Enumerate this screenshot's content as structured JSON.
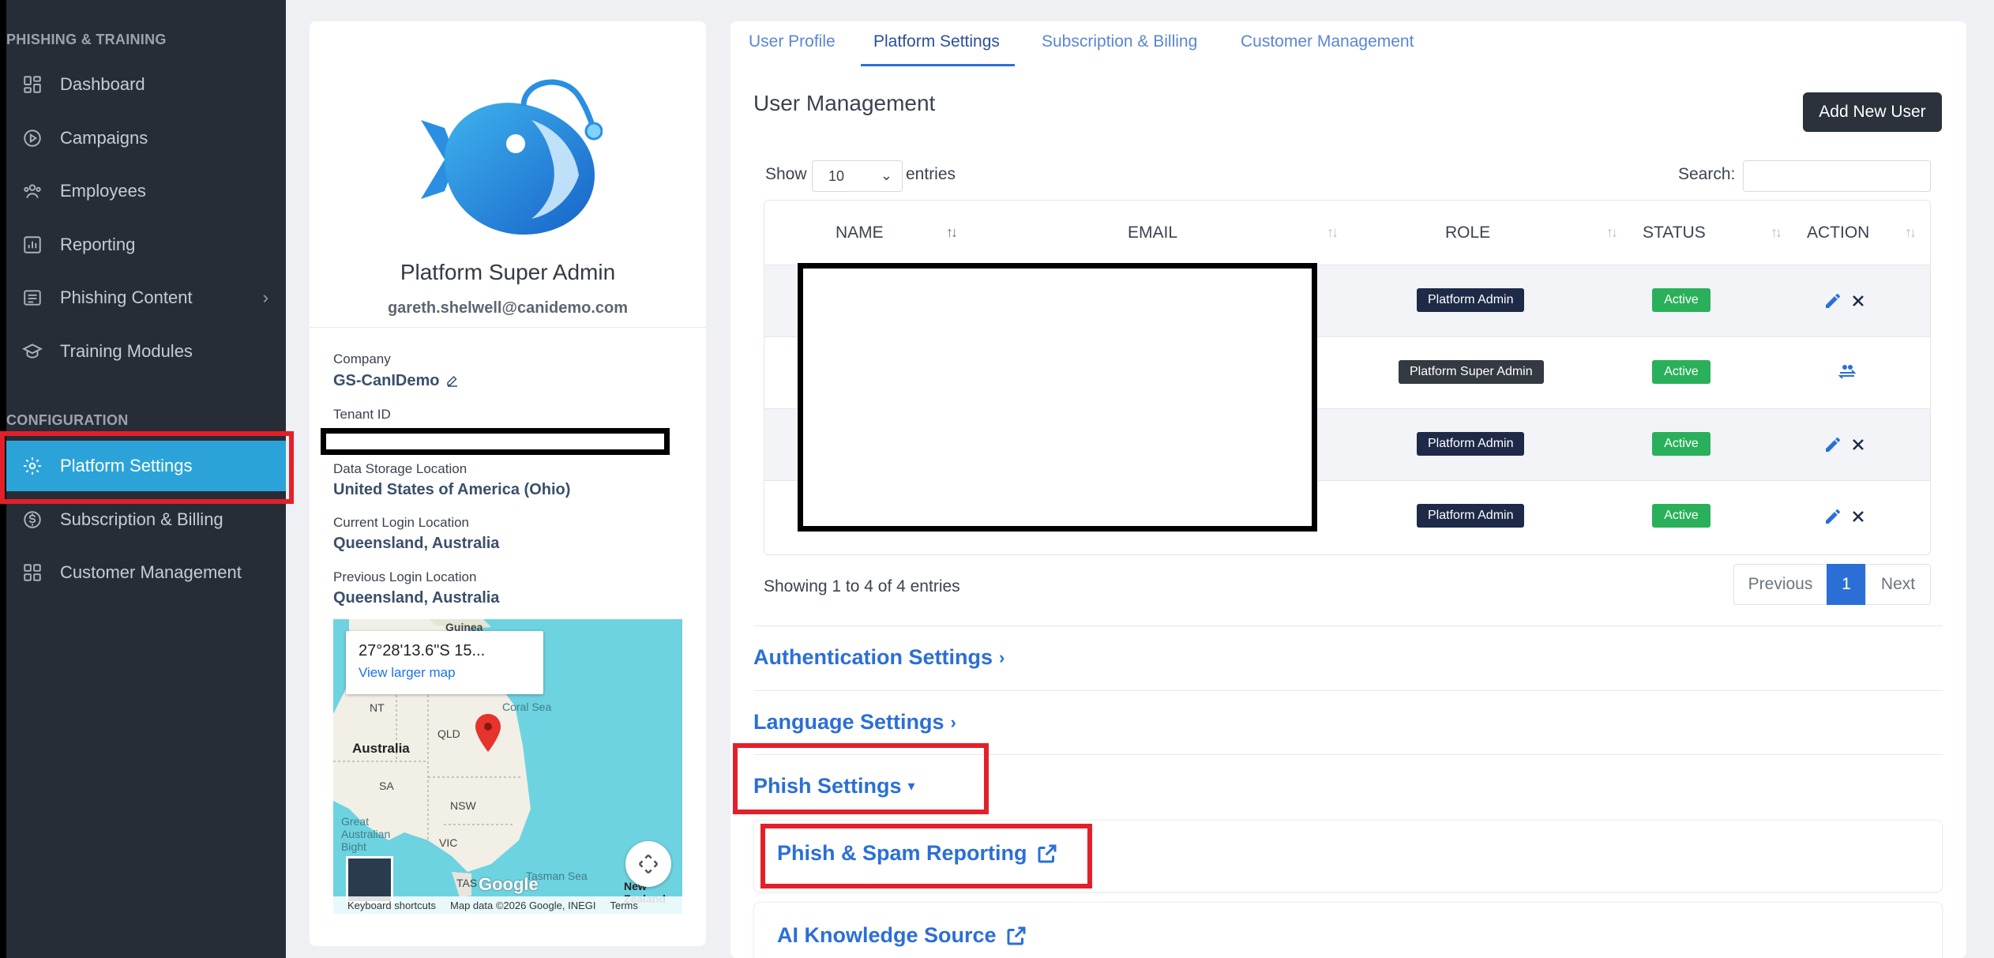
{
  "sidebar": {
    "section_phishing": "PHISHING & TRAINING",
    "section_config": "CONFIGURATION",
    "items": [
      {
        "label": "Dashboard",
        "icon": "dashboard-icon"
      },
      {
        "label": "Campaigns",
        "icon": "play-circle-icon"
      },
      {
        "label": "Employees",
        "icon": "users-icon"
      },
      {
        "label": "Reporting",
        "icon": "chart-icon"
      },
      {
        "label": "Phishing Content",
        "icon": "content-icon"
      },
      {
        "label": "Training Modules",
        "icon": "graduation-cap-icon"
      },
      {
        "label": "Platform Settings",
        "icon": "gear-icon"
      },
      {
        "label": "Subscription & Billing",
        "icon": "dollar-circle-icon"
      },
      {
        "label": "Customer Management",
        "icon": "grid-icon"
      }
    ]
  },
  "profile": {
    "name": "Platform Super Admin",
    "email": "gareth.shelwell@canidemo.com",
    "company_label": "Company",
    "company_value": "GS-CanIDemo",
    "tenant_label": "Tenant ID",
    "storage_label": "Data Storage Location",
    "storage_value": "United States of America (Ohio)",
    "current_login_label": "Current Login Location",
    "current_login_value": "Queensland, Australia",
    "previous_login_label": "Previous Login Location",
    "previous_login_value": "Queensland, Australia"
  },
  "map": {
    "coord": "27°28'13.6\"S 15...",
    "larger_link": "View larger map",
    "labels": {
      "guinea": "Guinea",
      "coral_sea": "Coral Sea",
      "nt": "NT",
      "qld": "QLD",
      "australia": "Australia",
      "sa": "SA",
      "nsw": "NSW",
      "great_bight": "Great\nAustralian\nBight",
      "vic": "VIC",
      "tas": "TAS",
      "tasman": "Tasman Sea",
      "nz": "New\nZealand"
    },
    "google": "Google",
    "footer_shortcuts": "Keyboard shortcuts",
    "footer_data": "Map data ©2026 Google, INEGI",
    "footer_terms": "Terms"
  },
  "tabs": [
    "User Profile",
    "Platform Settings",
    "Subscription & Billing",
    "Customer Management"
  ],
  "user_management": {
    "title": "User Management",
    "add_button": "Add New User",
    "show_label": "Show",
    "entries_value": "10",
    "entries_label": "entries",
    "search_label": "Search:",
    "columns": [
      "NAME",
      "EMAIL",
      "ROLE",
      "STATUS",
      "ACTION"
    ],
    "rows": [
      {
        "role": "Platform Admin",
        "status": "Active"
      },
      {
        "role": "Platform Super Admin",
        "status": "Active"
      },
      {
        "role": "Platform Admin",
        "status": "Active"
      },
      {
        "role": "Platform Admin",
        "status": "Active"
      }
    ],
    "showing": "Showing 1 to 4 of 4 entries",
    "pager_prev": "Previous",
    "pager_current": "1",
    "pager_next": "Next"
  },
  "accordions": {
    "auth": "Authentication Settings",
    "language": "Language Settings",
    "phish": "Phish Settings",
    "phish_spam": "Phish & Spam Reporting",
    "ai_knowledge": "AI Knowledge Source"
  },
  "colors": {
    "accent": "#2b6fd6",
    "sidebar_bg": "#272d36",
    "sidebar_active": "#2ba3d9",
    "status_active": "#2ab05a",
    "highlight": "#e3202a"
  }
}
